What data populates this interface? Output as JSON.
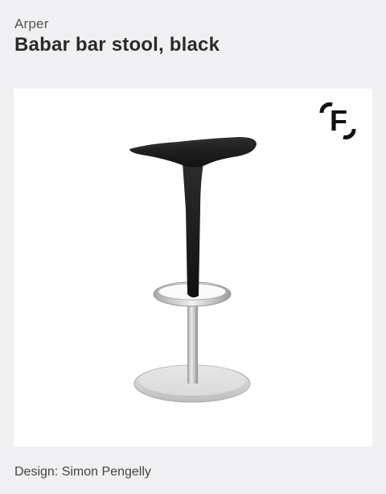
{
  "product": {
    "brand": "Arper",
    "title": "Babar bar stool, black",
    "designer": "Design: Simon Pengelly"
  },
  "image": {
    "logo_letter": "F",
    "background": "#ffffff",
    "seat_color": "#1c1c1c",
    "metal_color": "#c8c8c8"
  },
  "page": {
    "background": "#f0f0f2"
  }
}
